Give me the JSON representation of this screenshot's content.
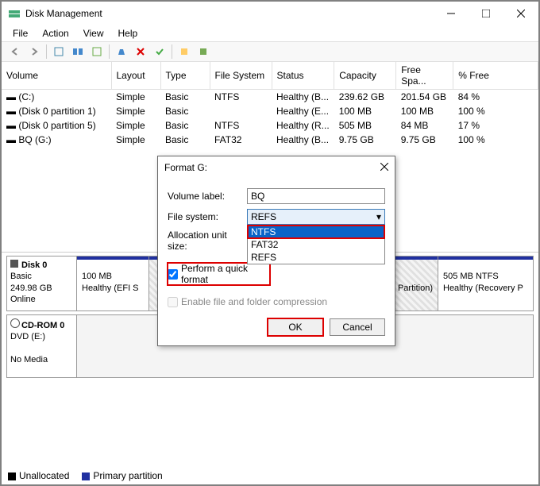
{
  "window": {
    "title": "Disk Management"
  },
  "menu": {
    "file": "File",
    "action": "Action",
    "view": "View",
    "help": "Help"
  },
  "columns": {
    "volume": "Volume",
    "layout": "Layout",
    "type": "Type",
    "fs": "File System",
    "status": "Status",
    "capacity": "Capacity",
    "free": "Free Spa...",
    "pct": "% Free"
  },
  "volumes": [
    {
      "name": "(C:)",
      "layout": "Simple",
      "type": "Basic",
      "fs": "NTFS",
      "status": "Healthy (B...",
      "cap": "239.62 GB",
      "free": "201.54 GB",
      "pct": "84 %"
    },
    {
      "name": "(Disk 0 partition 1)",
      "layout": "Simple",
      "type": "Basic",
      "fs": "",
      "status": "Healthy (E...",
      "cap": "100 MB",
      "free": "100 MB",
      "pct": "100 %"
    },
    {
      "name": "(Disk 0 partition 5)",
      "layout": "Simple",
      "type": "Basic",
      "fs": "NTFS",
      "status": "Healthy (R...",
      "cap": "505 MB",
      "free": "84 MB",
      "pct": "17 %"
    },
    {
      "name": "BQ (G:)",
      "layout": "Simple",
      "type": "Basic",
      "fs": "FAT32",
      "status": "Healthy (B...",
      "cap": "9.75 GB",
      "free": "9.75 GB",
      "pct": "100 %"
    }
  ],
  "disks": {
    "d0": {
      "name": "Disk 0",
      "type": "Basic",
      "size": "249.98 GB",
      "status": "Online"
    },
    "cd": {
      "name": "CD-ROM 0",
      "sub": "DVD (E:)",
      "media": "No Media"
    },
    "p1": {
      "l1": "100 MB",
      "l2": "Healthy (EFI S"
    },
    "p2": {
      "l1": "ata Partition)"
    },
    "p3": {
      "l1": "505 MB NTFS",
      "l2": "Healthy (Recovery P"
    }
  },
  "legend": {
    "unalloc": "Unallocated",
    "primary": "Primary partition"
  },
  "dialog": {
    "title": "Format G:",
    "volLabel": "Volume label:",
    "volValue": "BQ",
    "fsLabel": "File system:",
    "fsValue": "REFS",
    "allocLabel": "Allocation unit size:",
    "opts": {
      "ntfs": "NTFS",
      "fat32": "FAT32",
      "refs": "REFS"
    },
    "quick": "Perform a quick format",
    "compress": "Enable file and folder compression",
    "ok": "OK",
    "cancel": "Cancel"
  }
}
